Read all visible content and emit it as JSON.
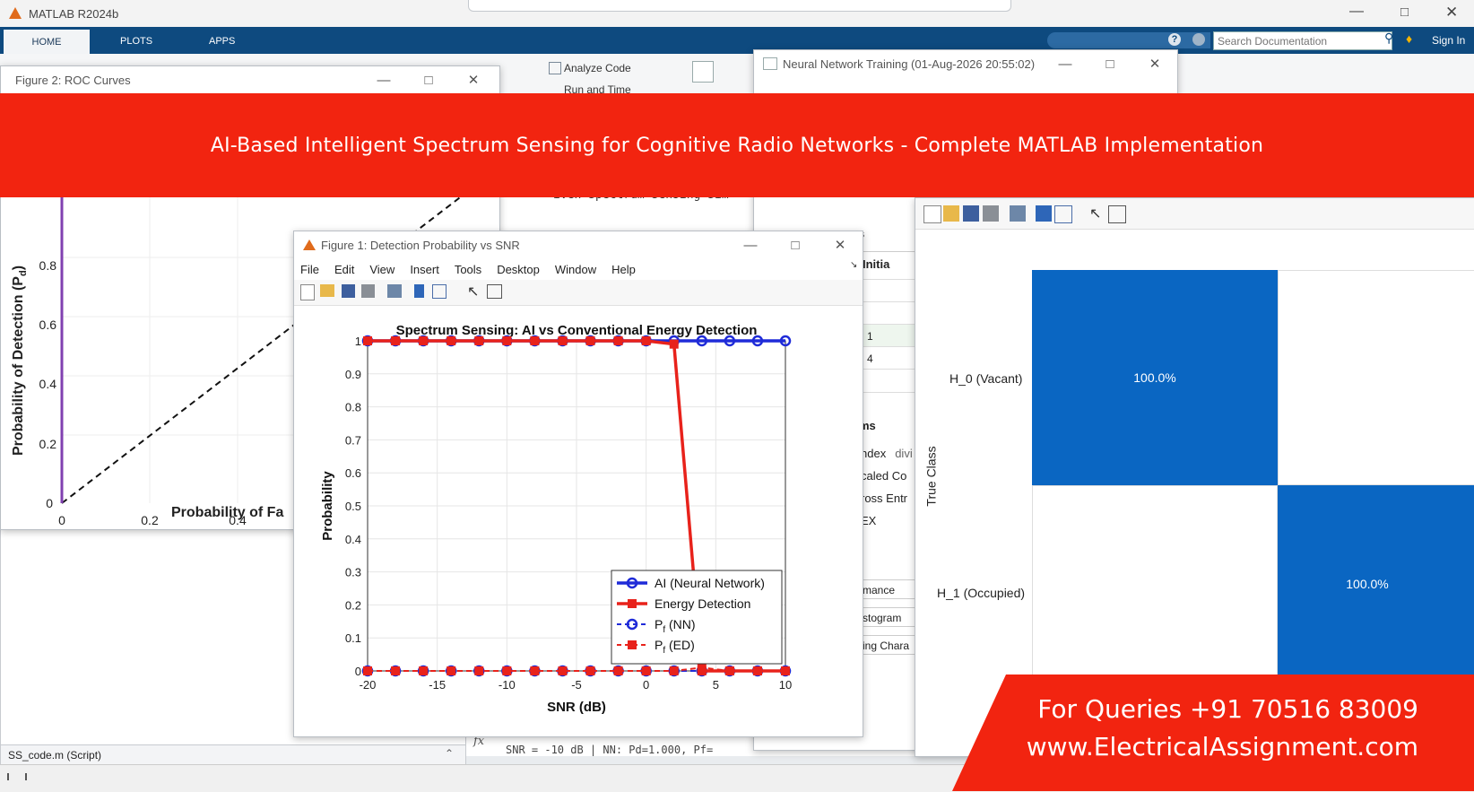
{
  "app": {
    "title": "MATLAB R2024b",
    "tabs": [
      "HOME",
      "PLOTS",
      "APPS"
    ],
    "search_placeholder": "Search Documentation",
    "sign_in": "Sign In",
    "toolstrip": {
      "analyze_code": "Analyze Code",
      "run_and_time": "Run and Time"
    }
  },
  "banner": {
    "text": "AI-Based Intelligent Spectrum Sensing for Cognitive Radio Networks - Complete MATLAB Implementation"
  },
  "roc_window": {
    "title": "Figure 2: ROC Curves",
    "ylabel_main": "Probability of Detection (P",
    "ylabel_sub": "d",
    "ylabel_end": ")",
    "xlabel_visible": "Probability of Fa",
    "yticks": [
      "0",
      "0.2",
      "0.4",
      "0.6",
      "0.8"
    ],
    "xticks": [
      "0",
      "0.2",
      "0.4"
    ]
  },
  "nn_window": {
    "title": "Neural Network Training (01-Aug-2026 20:55:02)",
    "table_header": "Initia",
    "table_values": [
      "1",
      "4"
    ],
    "section_fragment": "s",
    "row_fragment": "s",
    "algorithms_fragment": "ms",
    "algorithm_rows": [
      {
        "label": "ndex",
        "value": "divi"
      },
      {
        "label": "caled Co",
        "value": ""
      },
      {
        "label": "ross Entr",
        "value": ""
      },
      {
        "label": "EX",
        "value": ""
      }
    ],
    "plot_buttons": [
      "mance",
      "stogram",
      "ing Chara"
    ]
  },
  "editor": {
    "code_fragment": "iven Spectrum Sensing Sim",
    "code_fragment2": "s ",
    "script_label": "SS_code.m  (Script)",
    "command_fragment": "SNR = -10 dB | NN: Pd=1.000, Pf="
  },
  "confusion_window": {
    "ylabel": "True Class",
    "rows": [
      "H_0 (Vacant)",
      "H_1 (Occupied)"
    ],
    "cells": [
      "100.0%",
      "100.0%"
    ],
    "cell_color": "#0a66c2"
  },
  "fig1": {
    "title": "Figure 1: Detection Probability vs SNR",
    "menu": [
      "File",
      "Edit",
      "View",
      "Insert",
      "Tools",
      "Desktop",
      "Window",
      "Help"
    ]
  },
  "chart_data": {
    "type": "line",
    "title": "Spectrum Sensing: AI vs Conventional Energy Detection",
    "xlabel": "SNR (dB)",
    "ylabel": "Probability",
    "xlim": [
      -20,
      10
    ],
    "ylim": [
      0,
      1
    ],
    "xticks": [
      -20,
      -15,
      -10,
      -5,
      0,
      5,
      10
    ],
    "yticks": [
      0,
      0.1,
      0.2,
      0.3,
      0.4,
      0.5,
      0.6,
      0.7,
      0.8,
      0.9,
      1
    ],
    "grid": true,
    "legend_position": "bottom-right",
    "x": [
      -20,
      -18,
      -16,
      -14,
      -12,
      -10,
      -8,
      -6,
      -4,
      -2,
      0,
      2,
      4,
      6,
      8,
      10
    ],
    "series": [
      {
        "name": "AI (Neural Network)",
        "color": "#1f2bd8",
        "style": "solid",
        "marker": "circle",
        "values": [
          1,
          1,
          1,
          1,
          1,
          1,
          1,
          1,
          1,
          1,
          1,
          1,
          1,
          1,
          1,
          1
        ]
      },
      {
        "name": "Energy Detection",
        "color": "#e8221b",
        "style": "solid",
        "marker": "square",
        "values": [
          1,
          1,
          1,
          1,
          1,
          1,
          1,
          1,
          1,
          1,
          1,
          0.99,
          0,
          0,
          0,
          0
        ]
      },
      {
        "name": "P_f (NN)",
        "legend_main": "P",
        "legend_sub": "f",
        "legend_tail": " (NN)",
        "color": "#1f2bd8",
        "style": "dashed",
        "marker": "circle",
        "values": [
          0,
          0,
          0,
          0,
          0,
          0,
          0,
          0,
          0,
          0,
          0,
          0,
          0,
          0,
          0,
          0
        ]
      },
      {
        "name": "P_f (ED)",
        "legend_main": "P",
        "legend_sub": "f",
        "legend_tail": " (ED)",
        "color": "#e8221b",
        "style": "dashed",
        "marker": "square",
        "values": [
          0,
          0,
          0,
          0,
          0,
          0,
          0,
          0,
          0,
          0,
          0,
          0,
          0.01,
          0,
          0,
          0
        ]
      }
    ]
  },
  "promo": {
    "line1": "For Queries +91 70516 83009",
    "line2": "www.ElectricalAssignment.com",
    "color": "#f22410"
  }
}
